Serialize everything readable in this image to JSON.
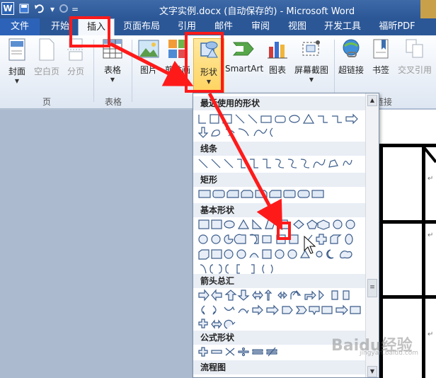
{
  "titlebar": {
    "logo": "W",
    "title": "文字实例.docx (自动保存的) - Microsoft Word"
  },
  "tabs": {
    "file": "文件",
    "items": [
      "开始",
      "插入",
      "页面布局",
      "引用",
      "邮件",
      "审阅",
      "视图",
      "开发工具",
      "福昕PDF"
    ],
    "active": "插入"
  },
  "ribbon": {
    "buttons": {
      "cover": "封面",
      "blank": "空白页",
      "pagebreak": "分页",
      "table": "表格",
      "picture": "图片",
      "clipart": "剪贴画",
      "shapes": "形状",
      "smartart": "SmartArt",
      "chart": "图表",
      "screenshot": "屏幕截图",
      "hyperlink": "超链接",
      "bookmark": "书签",
      "crossref": "交叉引用"
    },
    "groups": {
      "pages": "页",
      "tables": "表格",
      "links": "链接"
    }
  },
  "gallery": {
    "sections": [
      "最近使用的形状",
      "线条",
      "矩形",
      "基本形状",
      "箭头总汇",
      "公式形状",
      "流程图"
    ]
  },
  "watermark": {
    "brand": "Baidu经验",
    "url": "jingyan.baidu.com"
  },
  "colors": {
    "accent": "#2b5797",
    "annotation": "#ff1a1a",
    "highlight": "#ffd25a"
  }
}
